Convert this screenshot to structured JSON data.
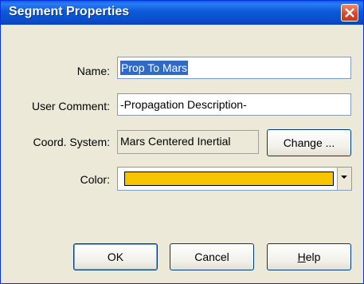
{
  "window": {
    "title": "Segment Properties"
  },
  "fields": {
    "name": {
      "label": "Name:",
      "value": "Prop To Mars"
    },
    "user_comment": {
      "label": "User Comment:",
      "value": "-Propagation Description-"
    },
    "coord_system": {
      "label": "Coord. System:",
      "value": "Mars Centered Inertial",
      "change_label": "Change ..."
    },
    "color": {
      "label": "Color:",
      "value": "#f6c400"
    }
  },
  "buttons": {
    "ok": "OK",
    "cancel": "Cancel",
    "help_mnemonic": "H",
    "help_rest": "elp"
  },
  "icons": {
    "close": "close-icon",
    "dropdown": "chevron-down-icon"
  }
}
